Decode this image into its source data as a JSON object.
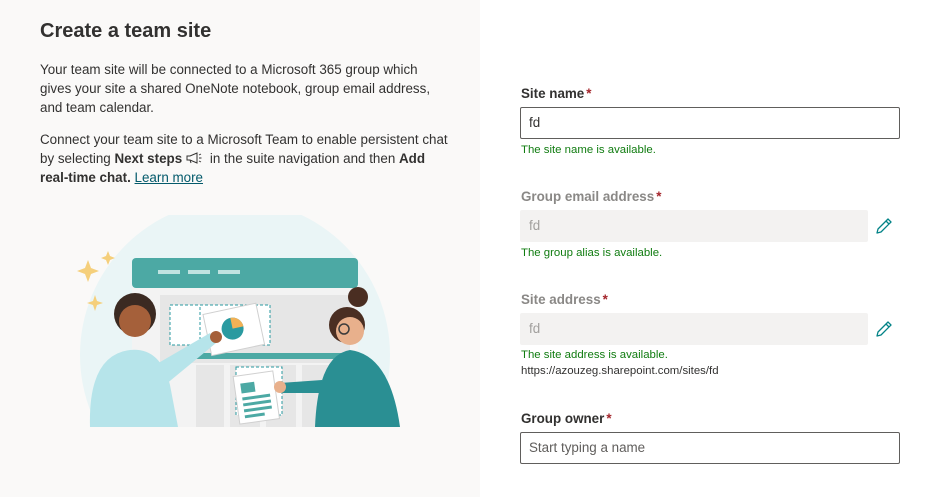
{
  "left": {
    "title": "Create a team site",
    "p1": "Your team site will be connected to a Microsoft 365 group which gives your site a shared OneNote notebook, group email address, and team calendar.",
    "p2_a": "Connect your team site to a Microsoft Team to enable persistent chat by selecting ",
    "p2_next": "Next steps",
    "p2_b": " in the suite navigation and then ",
    "p2_add": "Add real-time chat.",
    "learn_more": "Learn more"
  },
  "form": {
    "site_name": {
      "label": "Site name",
      "required": "*",
      "value": "fd",
      "message": "The site name is available."
    },
    "group_email": {
      "label": "Group email address",
      "required": "*",
      "value": "fd",
      "message": "The group alias is available."
    },
    "site_address": {
      "label": "Site address",
      "required": "*",
      "value": "fd",
      "message": "The site address is available.",
      "url": "https://azouzeg.sharepoint.com/sites/fd"
    },
    "group_owner": {
      "label": "Group owner",
      "required": "*",
      "placeholder": "Start typing a name"
    }
  },
  "colors": {
    "accent": "#038387",
    "success": "#107c10",
    "required": "#a4262c",
    "left_bg": "#faf9f8"
  }
}
